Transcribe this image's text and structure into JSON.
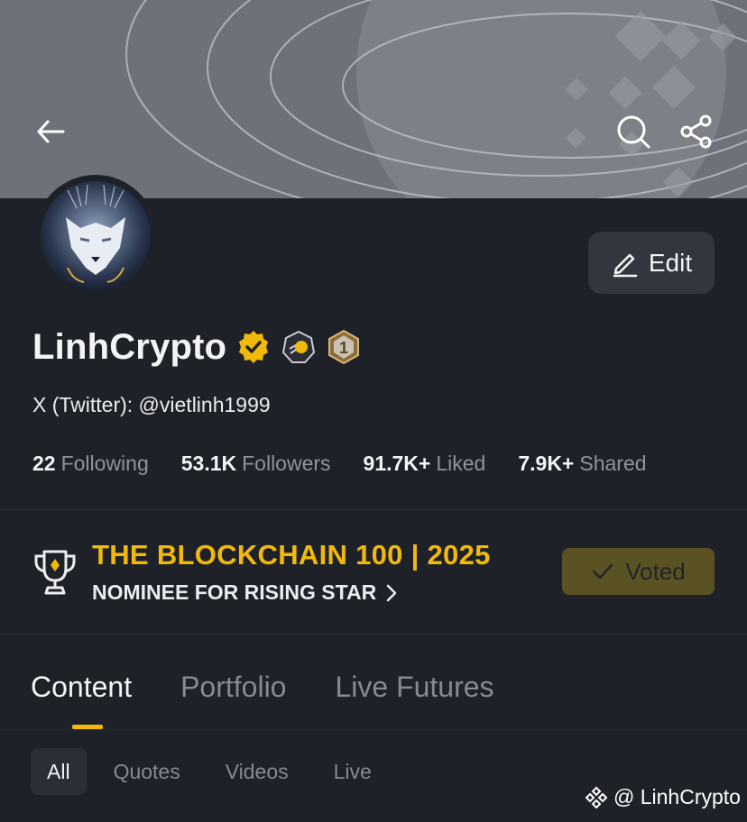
{
  "profile": {
    "name": "LinhCrypto",
    "social": "X (Twitter): @vietlinh1999",
    "edit_label": "Edit"
  },
  "stats": [
    {
      "value": "22",
      "label": "Following"
    },
    {
      "value": "53.1K",
      "label": "Followers"
    },
    {
      "value": "91.7K+",
      "label": "Liked"
    },
    {
      "value": "7.9K+",
      "label": "Shared"
    }
  ],
  "award": {
    "title": "THE BLOCKCHAIN 100 | 2025",
    "subtitle": "NOMINEE FOR RISING STAR",
    "voted_label": "Voted"
  },
  "tabs": [
    {
      "label": "Content",
      "active": true
    },
    {
      "label": "Portfolio",
      "active": false
    },
    {
      "label": "Live Futures",
      "active": false
    }
  ],
  "filters": [
    {
      "label": "All",
      "active": true
    },
    {
      "label": "Quotes",
      "active": false
    },
    {
      "label": "Videos",
      "active": false
    },
    {
      "label": "Live",
      "active": false
    }
  ],
  "watermark": "@ LinhCrypto",
  "badges": {
    "rank_number": "1"
  },
  "colors": {
    "accent": "#f0b90b",
    "background": "#1f2128",
    "banner": "#6e7179"
  }
}
